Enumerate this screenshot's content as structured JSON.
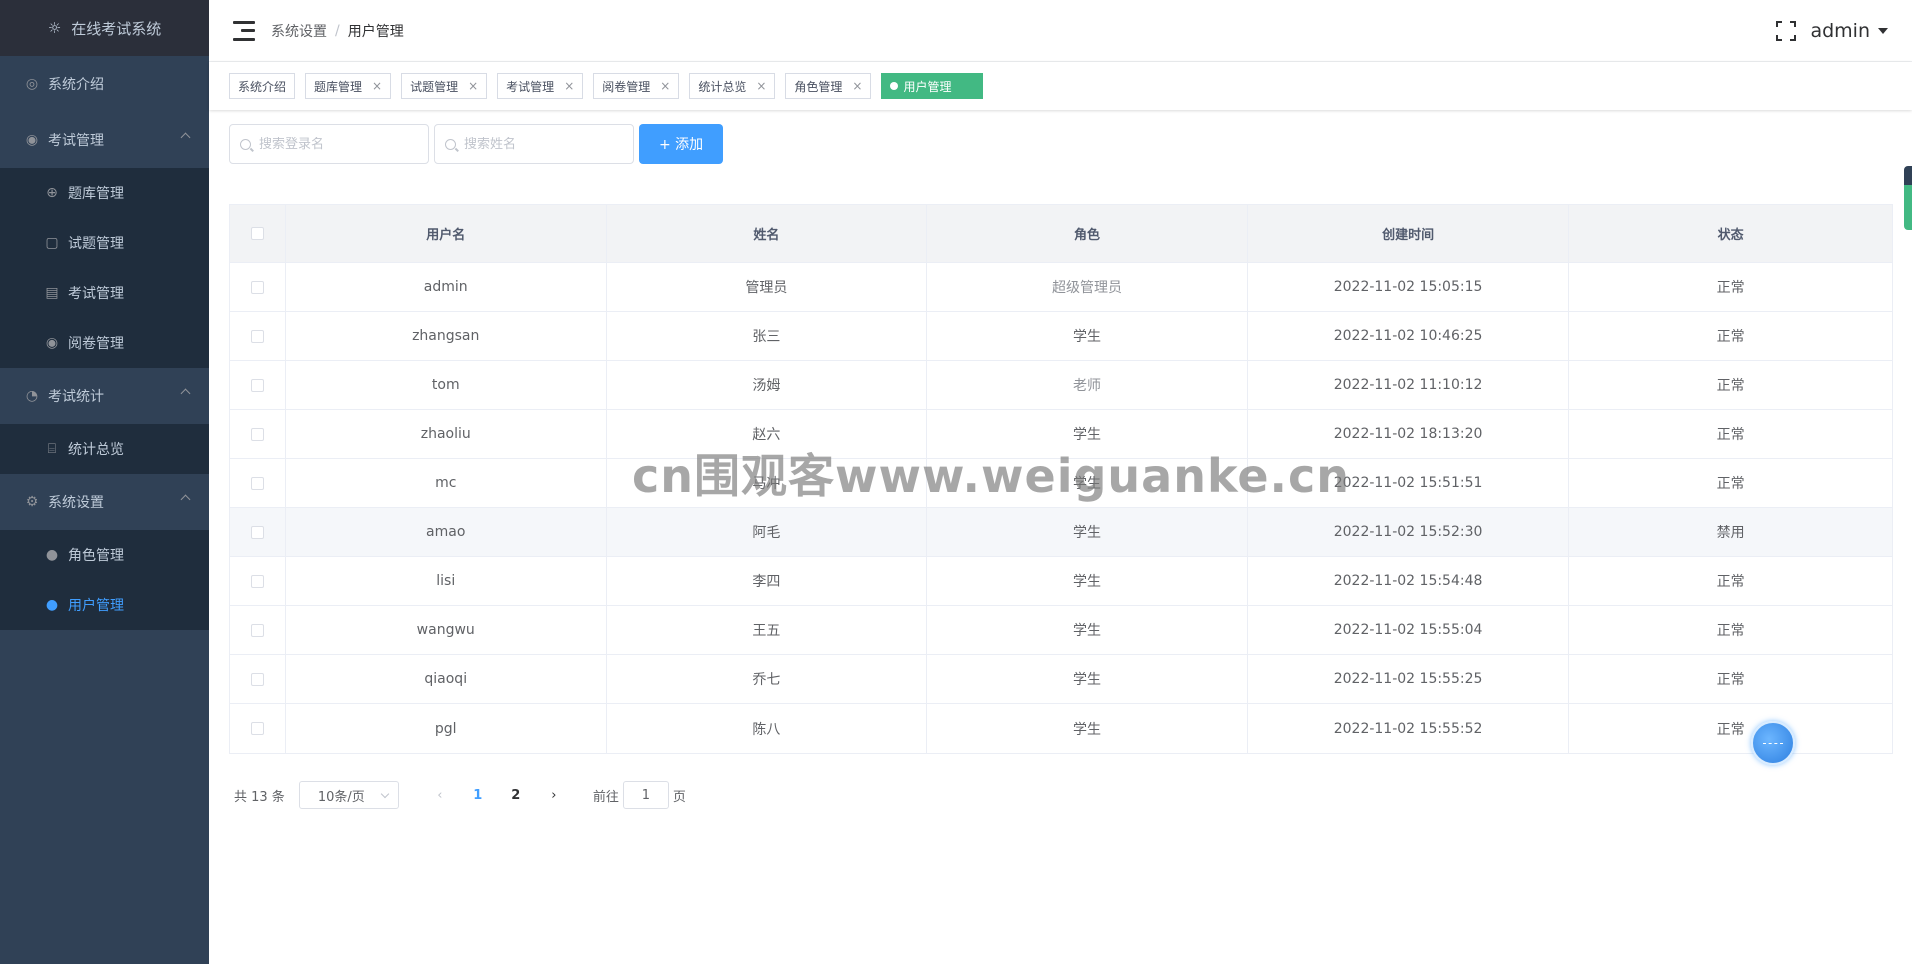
{
  "app": {
    "title": "在线考试系统"
  },
  "sidebar": {
    "items": [
      {
        "label": "系统介绍",
        "icon": "compass-icon"
      },
      {
        "label": "考试管理",
        "icon": "settings-icon",
        "children": [
          {
            "label": "题库管理",
            "icon": "target-icon"
          },
          {
            "label": "试题管理",
            "icon": "edit-icon"
          },
          {
            "label": "考试管理",
            "icon": "document-icon"
          },
          {
            "label": "阅卷管理",
            "icon": "eye-icon"
          }
        ]
      },
      {
        "label": "考试统计",
        "icon": "pie-chart-icon",
        "children": [
          {
            "label": "统计总览",
            "icon": "presentation-icon"
          }
        ]
      },
      {
        "label": "系统设置",
        "icon": "gear-icon",
        "children": [
          {
            "label": "角色管理",
            "icon": "user-icon"
          },
          {
            "label": "用户管理",
            "icon": "user-icon",
            "active": true
          }
        ]
      }
    ]
  },
  "navbar": {
    "breadcrumb": [
      "系统设置",
      "用户管理"
    ],
    "breadcrumb_sep": "/",
    "user": "admin"
  },
  "tags": [
    "系统介绍",
    "题库管理",
    "试题管理",
    "考试管理",
    "阅卷管理",
    "统计总览",
    "角色管理",
    "用户管理"
  ],
  "tag_close": "×",
  "filters": {
    "login_placeholder": "搜索登录名",
    "name_placeholder": "搜索姓名",
    "add_label": "+ 添加"
  },
  "table": {
    "headers": [
      "用户名",
      "姓名",
      "角色",
      "创建时间",
      "状态"
    ],
    "rows": [
      [
        "admin",
        "管理员",
        "超级管理员",
        "2022-11-02 15:05:15",
        "正常"
      ],
      [
        "zhangsan",
        "张三",
        "学生",
        "2022-11-02 10:46:25",
        "正常"
      ],
      [
        "tom",
        "汤姆",
        "老师",
        "2022-11-02 11:10:12",
        "正常"
      ],
      [
        "zhaoliu",
        "赵六",
        "学生",
        "2022-11-02 18:13:20",
        "正常"
      ],
      [
        "mc",
        "马冲",
        "学生",
        "2022-11-02 15:51:51",
        "正常"
      ],
      [
        "amao",
        "阿毛",
        "学生",
        "2022-11-02 15:52:30",
        "禁用"
      ],
      [
        "lisi",
        "李四",
        "学生",
        "2022-11-02 15:54:48",
        "正常"
      ],
      [
        "wangwu",
        "王五",
        "学生",
        "2022-11-02 15:55:04",
        "正常"
      ],
      [
        "qiaoqi",
        "乔七",
        "学生",
        "2022-11-02 15:55:25",
        "正常"
      ],
      [
        "pgl",
        "陈八",
        "学生",
        "2022-11-02 15:55:52",
        "正常"
      ]
    ]
  },
  "pagination": {
    "total": "共 13 条",
    "page_size": "10条/页",
    "pages": [
      "1",
      "2"
    ],
    "current": "1",
    "goto_prefix": "前往",
    "goto_value": "1",
    "goto_suffix": "页"
  },
  "watermark": "cn围观客www.weiguanke.cn",
  "colors": {
    "sidebar": "#304156",
    "accent": "#409eff",
    "active_tag": "#42b983"
  }
}
